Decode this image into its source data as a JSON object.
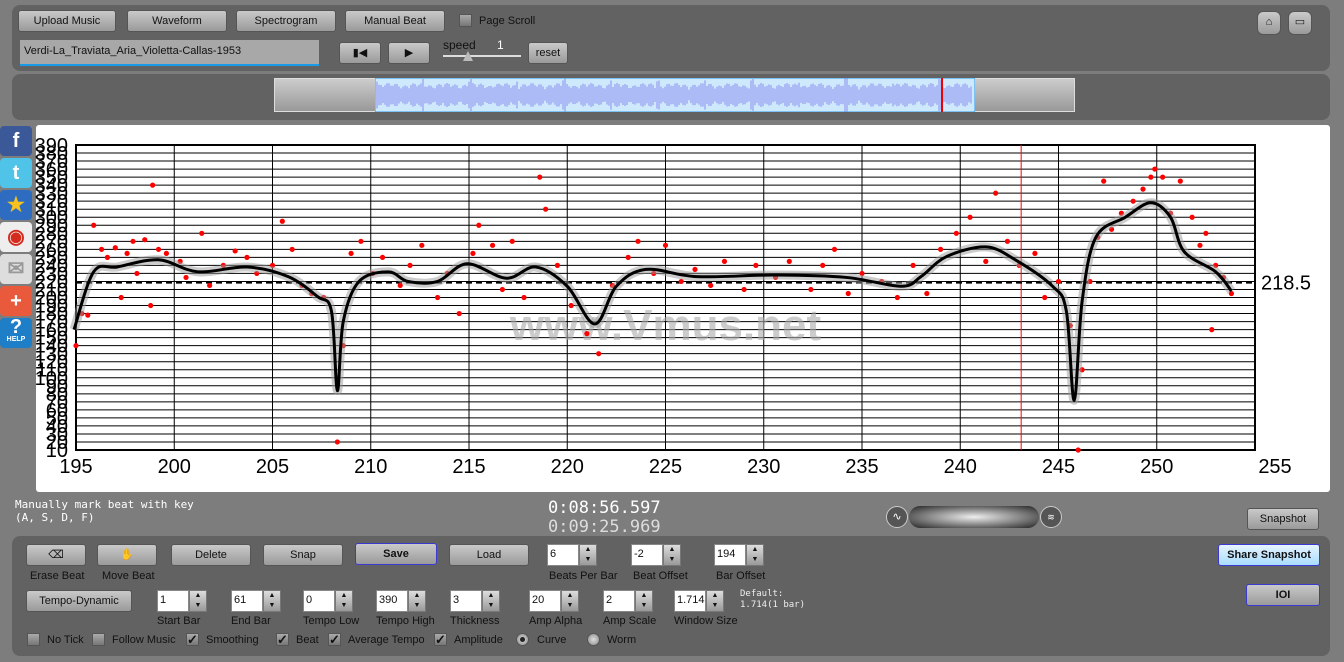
{
  "toolbar": {
    "upload": "Upload Music",
    "waveform": "Waveform",
    "spectrogram": "Spectrogram",
    "manual_beat": "Manual Beat",
    "page_scroll": "Page Scroll",
    "track_name": "Verdi-La_Traviata_Aria_Violetta-Callas-1953",
    "speed_label": "speed",
    "speed_value": "1",
    "reset": "reset",
    "icons": [
      "rewind-icon",
      "play-icon",
      "home-icon",
      "fullscreen-icon"
    ]
  },
  "social": [
    "facebook-icon",
    "twitter-icon",
    "qzone-icon",
    "weibo-icon",
    "email-icon",
    "add-icon",
    "help-icon"
  ],
  "social_help_text": "HELP",
  "watermark": "www.Vmus.net",
  "info": {
    "hint_line1": "Manually mark beat with key",
    "hint_line2": "(A, S, D, F)",
    "time_current": "0:08:56.597",
    "time_total": "0:09:25.969",
    "snapshot": "Snapshot",
    "share_snapshot": "Share Snapshot",
    "ioi": "IOI"
  },
  "controls": {
    "erase_beat": "Erase Beat",
    "move_beat": "Move Beat",
    "delete": "Delete",
    "snap": "Snap",
    "save": "Save",
    "load": "Load",
    "tempo_dynamic": "Tempo-Dynamic",
    "beats_per_bar": {
      "label": "Beats Per Bar",
      "value": "6"
    },
    "beat_offset": {
      "label": "Beat Offset",
      "value": "-2"
    },
    "bar_offset": {
      "label": "Bar Offset",
      "value": "194"
    },
    "start_bar": {
      "label": "Start Bar",
      "value": "1"
    },
    "end_bar": {
      "label": "End Bar",
      "value": "61"
    },
    "tempo_low": {
      "label": "Tempo Low",
      "value": "0"
    },
    "tempo_high": {
      "label": "Tempo High",
      "value": "390"
    },
    "thickness": {
      "label": "Thickness",
      "value": "3"
    },
    "amp_alpha": {
      "label": "Amp Alpha",
      "value": "20"
    },
    "amp_scale": {
      "label": "Amp Scale",
      "value": "2"
    },
    "window_size": {
      "label": "Window Size",
      "value": "1.714"
    },
    "default_line1": "Default:",
    "default_line2": "1.714(1 bar)",
    "checks": {
      "no_tick": {
        "label": "No Tick",
        "checked": false
      },
      "follow_music": {
        "label": "Follow Music",
        "checked": false
      },
      "smoothing": {
        "label": "Smoothing",
        "checked": true
      },
      "beat": {
        "label": "Beat",
        "checked": true
      },
      "average_tempo": {
        "label": "Average Tempo",
        "checked": true
      },
      "amplitude": {
        "label": "Amplitude",
        "checked": true
      }
    },
    "radios": {
      "curve": {
        "label": "Curve",
        "selected": true
      },
      "worm": {
        "label": "Worm",
        "selected": false
      }
    }
  },
  "chart_data": {
    "type": "line",
    "xlim": [
      195,
      255
    ],
    "ylim": [
      10,
      390
    ],
    "xticks": [
      195,
      200,
      205,
      210,
      215,
      220,
      225,
      230,
      235,
      240,
      245,
      250,
      255
    ],
    "yticks": [
      10,
      20,
      30,
      40,
      50,
      60,
      70,
      80,
      90,
      100,
      110,
      120,
      130,
      140,
      150,
      160,
      170,
      180,
      190,
      200,
      210,
      220,
      230,
      240,
      250,
      260,
      270,
      280,
      290,
      300,
      310,
      320,
      330,
      340,
      350,
      360,
      370,
      380,
      390
    ],
    "grid": true,
    "average_tempo": 218.5,
    "average_label": "218.5",
    "cursor_bar": 243.1,
    "colors": {
      "curve": "#000000",
      "points": "#ff0000",
      "cursor": "#ff0000"
    },
    "curve": [
      [
        194.9,
        160
      ],
      [
        195.9,
        232
      ],
      [
        197.1,
        238
      ],
      [
        199.2,
        247
      ],
      [
        201.2,
        232
      ],
      [
        203.7,
        238
      ],
      [
        205.8,
        226
      ],
      [
        207.3,
        201
      ],
      [
        208.0,
        183
      ],
      [
        208.3,
        84
      ],
      [
        208.6,
        170
      ],
      [
        209.4,
        220
      ],
      [
        210.9,
        232
      ],
      [
        211.9,
        220
      ],
      [
        213.4,
        220
      ],
      [
        214.9,
        242
      ],
      [
        216.9,
        224
      ],
      [
        218.4,
        238
      ],
      [
        220.0,
        214
      ],
      [
        221.4,
        167
      ],
      [
        222.5,
        214
      ],
      [
        224.0,
        235
      ],
      [
        226.6,
        226
      ],
      [
        230.6,
        228
      ],
      [
        234.2,
        225
      ],
      [
        237.0,
        214
      ],
      [
        238.0,
        226
      ],
      [
        239.3,
        251
      ],
      [
        241.3,
        263
      ],
      [
        242.8,
        247
      ],
      [
        244.7,
        214
      ],
      [
        245.4,
        183
      ],
      [
        245.8,
        72
      ],
      [
        246.2,
        195
      ],
      [
        246.9,
        275
      ],
      [
        248.4,
        300
      ],
      [
        249.7,
        318
      ],
      [
        250.7,
        300
      ],
      [
        251.4,
        257
      ],
      [
        253.0,
        232
      ],
      [
        253.8,
        208
      ]
    ],
    "points": [
      [
        195.0,
        140
      ],
      [
        195.3,
        180
      ],
      [
        195.6,
        178
      ],
      [
        195.9,
        290
      ],
      [
        196.3,
        260
      ],
      [
        196.6,
        250
      ],
      [
        197.0,
        262
      ],
      [
        197.3,
        200
      ],
      [
        197.6,
        255
      ],
      [
        197.9,
        270
      ],
      [
        198.1,
        230
      ],
      [
        198.5,
        272
      ],
      [
        198.8,
        190
      ],
      [
        198.9,
        340
      ],
      [
        199.2,
        260
      ],
      [
        199.6,
        255
      ],
      [
        200.3,
        245
      ],
      [
        200.6,
        225
      ],
      [
        201.4,
        280
      ],
      [
        201.8,
        215
      ],
      [
        202.5,
        240
      ],
      [
        203.1,
        258
      ],
      [
        203.7,
        250
      ],
      [
        204.2,
        230
      ],
      [
        205.0,
        240
      ],
      [
        205.5,
        295
      ],
      [
        206.0,
        260
      ],
      [
        206.5,
        215
      ],
      [
        207.0,
        205
      ],
      [
        207.6,
        200
      ],
      [
        208.3,
        20
      ],
      [
        208.6,
        140
      ],
      [
        209.0,
        255
      ],
      [
        209.5,
        270
      ],
      [
        210.1,
        230
      ],
      [
        210.6,
        250
      ],
      [
        211.5,
        215
      ],
      [
        212.0,
        240
      ],
      [
        212.6,
        265
      ],
      [
        213.4,
        200
      ],
      [
        213.9,
        230
      ],
      [
        214.5,
        180
      ],
      [
        215.2,
        255
      ],
      [
        215.5,
        290
      ],
      [
        216.2,
        265
      ],
      [
        216.7,
        210
      ],
      [
        217.2,
        270
      ],
      [
        217.8,
        200
      ],
      [
        218.6,
        350
      ],
      [
        218.9,
        310
      ],
      [
        219.5,
        240
      ],
      [
        220.2,
        190
      ],
      [
        221.0,
        155
      ],
      [
        221.6,
        130
      ],
      [
        222.3,
        215
      ],
      [
        223.1,
        250
      ],
      [
        223.6,
        270
      ],
      [
        224.4,
        230
      ],
      [
        225.0,
        265
      ],
      [
        225.8,
        220
      ],
      [
        226.5,
        235
      ],
      [
        227.3,
        215
      ],
      [
        228.0,
        245
      ],
      [
        229.0,
        210
      ],
      [
        229.6,
        240
      ],
      [
        230.6,
        225
      ],
      [
        231.3,
        245
      ],
      [
        232.4,
        210
      ],
      [
        233.0,
        240
      ],
      [
        233.6,
        260
      ],
      [
        234.3,
        205
      ],
      [
        235.0,
        230
      ],
      [
        236.0,
        220
      ],
      [
        236.8,
        200
      ],
      [
        237.6,
        240
      ],
      [
        238.3,
        205
      ],
      [
        239.0,
        260
      ],
      [
        239.8,
        280
      ],
      [
        240.5,
        300
      ],
      [
        241.3,
        245
      ],
      [
        241.8,
        330
      ],
      [
        242.4,
        270
      ],
      [
        243.0,
        240
      ],
      [
        243.8,
        255
      ],
      [
        244.3,
        200
      ],
      [
        245.0,
        220
      ],
      [
        245.6,
        165
      ],
      [
        246.0,
        10
      ],
      [
        246.2,
        110
      ],
      [
        246.6,
        220
      ],
      [
        247.0,
        275
      ],
      [
        247.3,
        345
      ],
      [
        247.7,
        285
      ],
      [
        248.2,
        305
      ],
      [
        248.8,
        320
      ],
      [
        249.3,
        335
      ],
      [
        249.7,
        350
      ],
      [
        249.9,
        360
      ],
      [
        250.3,
        350
      ],
      [
        250.7,
        305
      ],
      [
        251.2,
        345
      ],
      [
        251.8,
        300
      ],
      [
        252.2,
        265
      ],
      [
        252.5,
        280
      ],
      [
        252.8,
        160
      ],
      [
        253.0,
        240
      ],
      [
        253.4,
        225
      ],
      [
        253.8,
        205
      ]
    ]
  }
}
